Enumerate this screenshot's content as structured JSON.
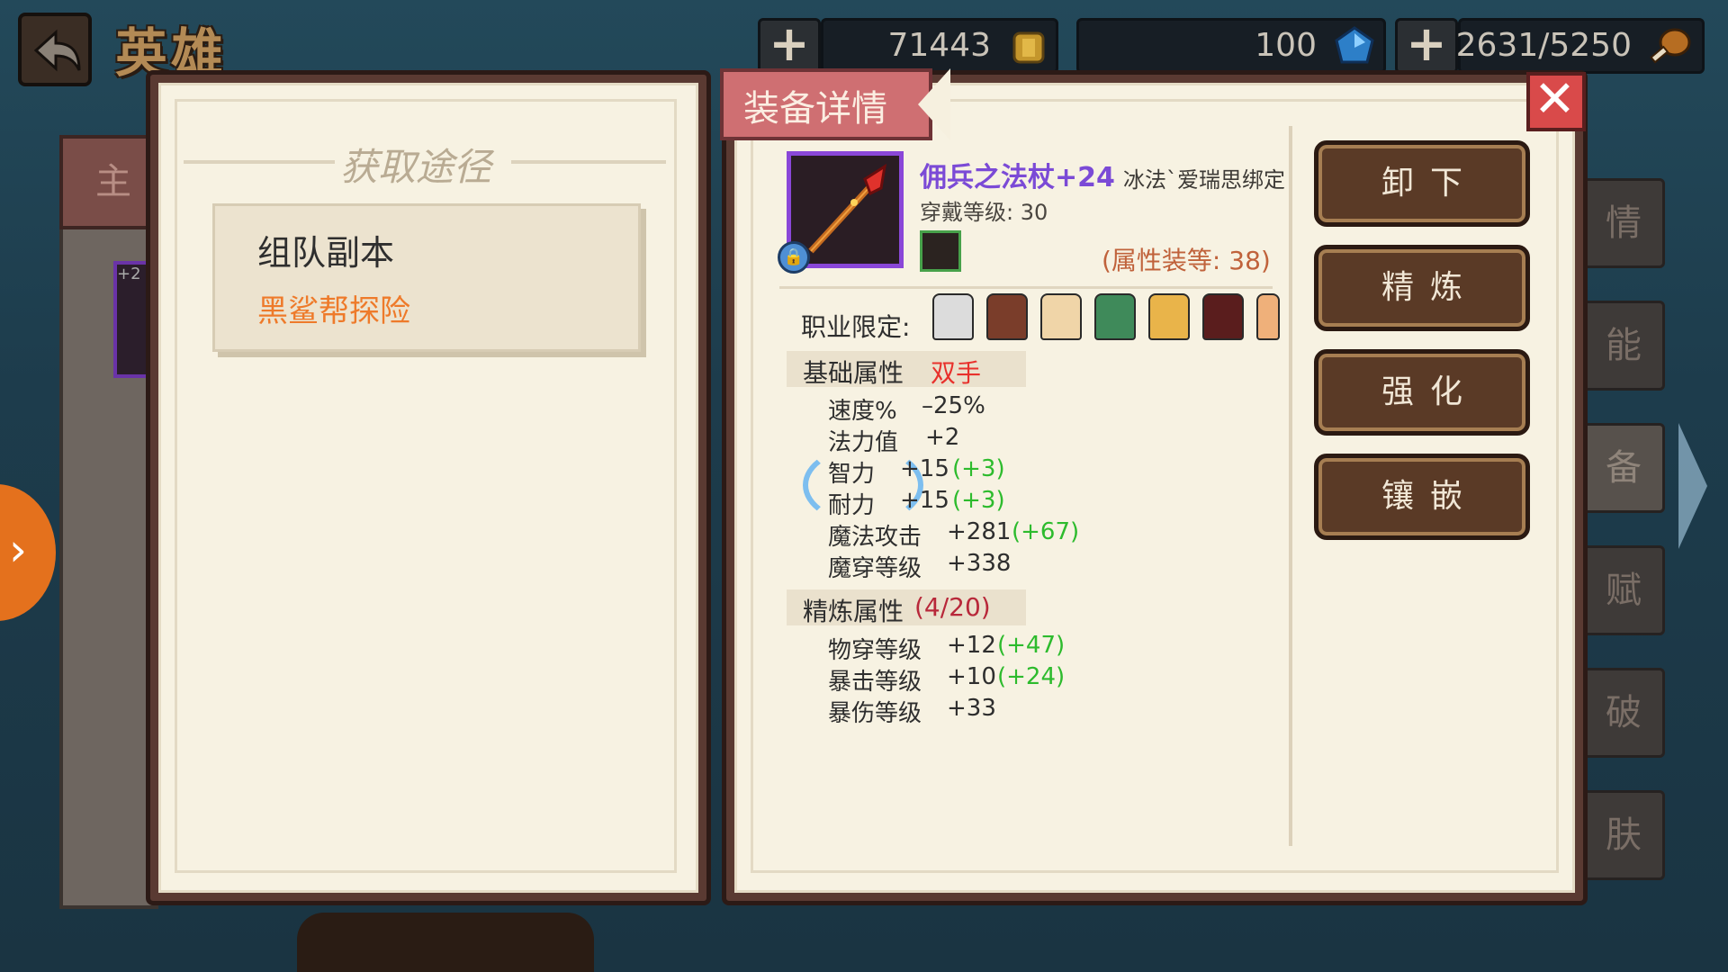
{
  "header": {
    "title": "英雄",
    "gold": "71443",
    "gems": "100",
    "stamina": "2631/5250"
  },
  "background": {
    "left_tab": "主",
    "left_item_text": "+2",
    "side_tabs": [
      "情",
      "能",
      "备",
      "赋",
      "破",
      "肤"
    ]
  },
  "source_panel": {
    "title": "获取途径",
    "source_type": "组队副本",
    "source_name": "黑鲨帮探险"
  },
  "detail_panel": {
    "ribbon": "装备详情",
    "item_name": "佣兵之法杖+24",
    "bind_text": "冰法`爱瑞思绑定",
    "wear_level": "穿戴等级: 30",
    "attr_equip_level": "(属性装等: 38)",
    "job_label": "职业限定:",
    "base_section": "基础属性",
    "base_section_note": "双手",
    "base_stats": [
      {
        "name": "速度%",
        "value": "–25%",
        "bonus": ""
      },
      {
        "name": "法力值",
        "value": "+2",
        "bonus": ""
      },
      {
        "name": "智力",
        "value": "+15",
        "bonus": "(+3)"
      },
      {
        "name": "耐力",
        "value": "+15",
        "bonus": "(+3)"
      },
      {
        "name": "魔法攻击",
        "value": "+281",
        "bonus": "(+67)"
      },
      {
        "name": "魔穿等级",
        "value": "+338",
        "bonus": ""
      }
    ],
    "refine_section": "精炼属性",
    "refine_progress": "(4/20)",
    "refine_stats": [
      {
        "name": "物穿等级",
        "value": "+12",
        "bonus": "(+47)"
      },
      {
        "name": "暴击等级",
        "value": "+10",
        "bonus": "(+24)"
      },
      {
        "name": "暴伤等级",
        "value": "+33",
        "bonus": ""
      }
    ]
  },
  "actions": {
    "unequip": "卸下",
    "refine": "精炼",
    "enhance": "强化",
    "socket": "镶嵌"
  },
  "colors": {
    "item_name": "#7b4ad6",
    "source_name": "#ee7a2a",
    "bonus_green": "#2dbb2d",
    "hand_red": "#e8312c",
    "refine_red": "#b8283a"
  },
  "icons": [
    "back-arrow-icon",
    "gold-coin-icon",
    "blue-gem-icon",
    "stamina-drumstick-icon",
    "close-icon",
    "staff-icon",
    "lock-icon"
  ]
}
